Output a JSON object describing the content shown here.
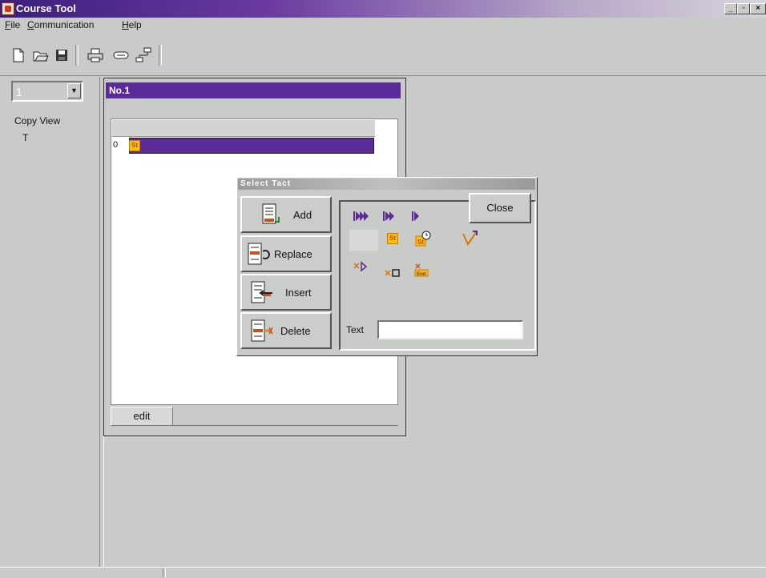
{
  "window": {
    "title": "Course Tool"
  },
  "menu": {
    "items": [
      {
        "label": "File",
        "accel": "F",
        "rest": "ile"
      },
      {
        "label": "Communication",
        "accel": "C",
        "rest": "ommunication"
      },
      {
        "label": "Help",
        "accel": "H",
        "rest": "elp"
      }
    ]
  },
  "toolbar": {
    "icons": [
      "new-document-icon",
      "open-folder-icon",
      "save-disk-icon",
      "print-icon",
      "connector-icon",
      "network-icon"
    ]
  },
  "left_pane": {
    "combo_value": "1",
    "view_label": "Copy View",
    "tree_item": "T"
  },
  "document": {
    "title": "No.1",
    "row_number": "0",
    "row_badge": "St",
    "tab_label": "edit"
  },
  "dialog": {
    "title": "Select Tact",
    "buttons": {
      "add": "Add",
      "replace": "Replace",
      "insert": "Insert",
      "delete": "Delete",
      "close": "Close"
    },
    "palette_badge": "St",
    "text_label": "Text",
    "text_value": ""
  },
  "colors": {
    "title_bar": "#3a1f7d",
    "selection": "#5a2a98",
    "badge": "#f5c400",
    "face": "#c9cbc9"
  }
}
